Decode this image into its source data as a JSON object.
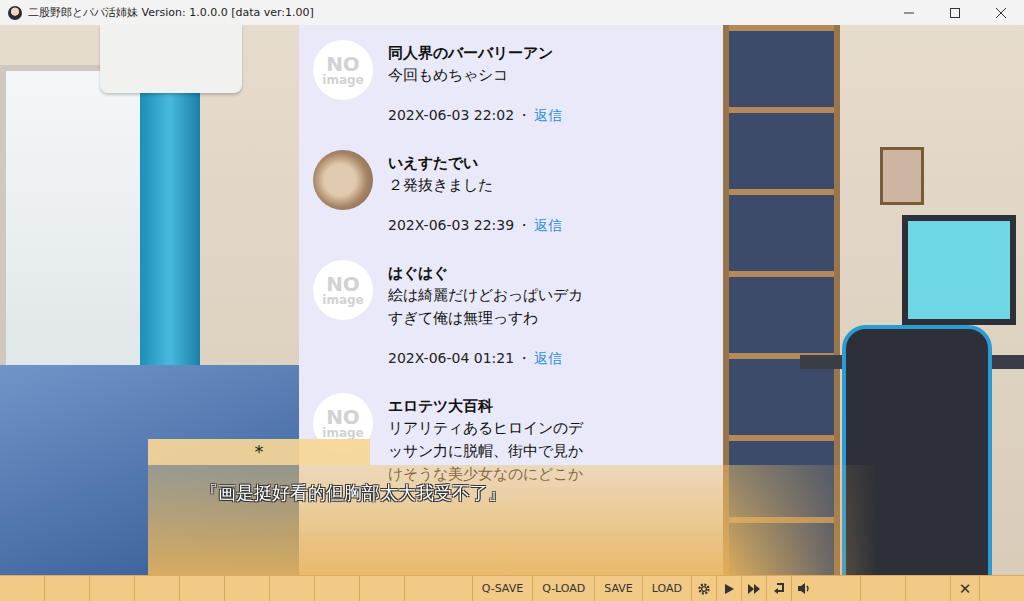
{
  "window": {
    "title": "二股野郎とパパ活姉妹 Version: 1.0.0.0 [data ver:1.00]"
  },
  "comments": [
    {
      "kind": "placeholder",
      "avatar_lines": [
        "NO",
        "image"
      ],
      "name": "同人界のバーバリーアン",
      "body": "今回もめちゃシコ",
      "time": "202X-06-03 22:02",
      "reply": "返信"
    },
    {
      "kind": "photo",
      "avatar_lines": [],
      "name": "いえすたでい",
      "body": "２発抜きました",
      "time": "202X-06-03 22:39",
      "reply": "返信"
    },
    {
      "kind": "placeholder",
      "avatar_lines": [
        "NO",
        "image"
      ],
      "name": "はぐはぐ",
      "body": "絵は綺麗だけどおっぱいデカすぎて俺は無理っすわ",
      "time": "202X-06-04 01:21",
      "reply": "返信"
    },
    {
      "kind": "placeholder",
      "avatar_lines": [
        "NO",
        "image"
      ],
      "name": "エロテツ大百科",
      "body": "リアリティあるヒロインのデッサン力に脱帽、街中で見かけそうな美少女なのにどこか",
      "time": "",
      "reply": ""
    }
  ],
  "separator": "・",
  "dialog": {
    "speaker": "*",
    "text": "『画是挺好看的但胸部太大我受不了』"
  },
  "toolbar": {
    "buttons": [
      "Q-SAVE",
      "Q-LOAD",
      "SAVE",
      "LOAD"
    ],
    "close": "✕"
  }
}
